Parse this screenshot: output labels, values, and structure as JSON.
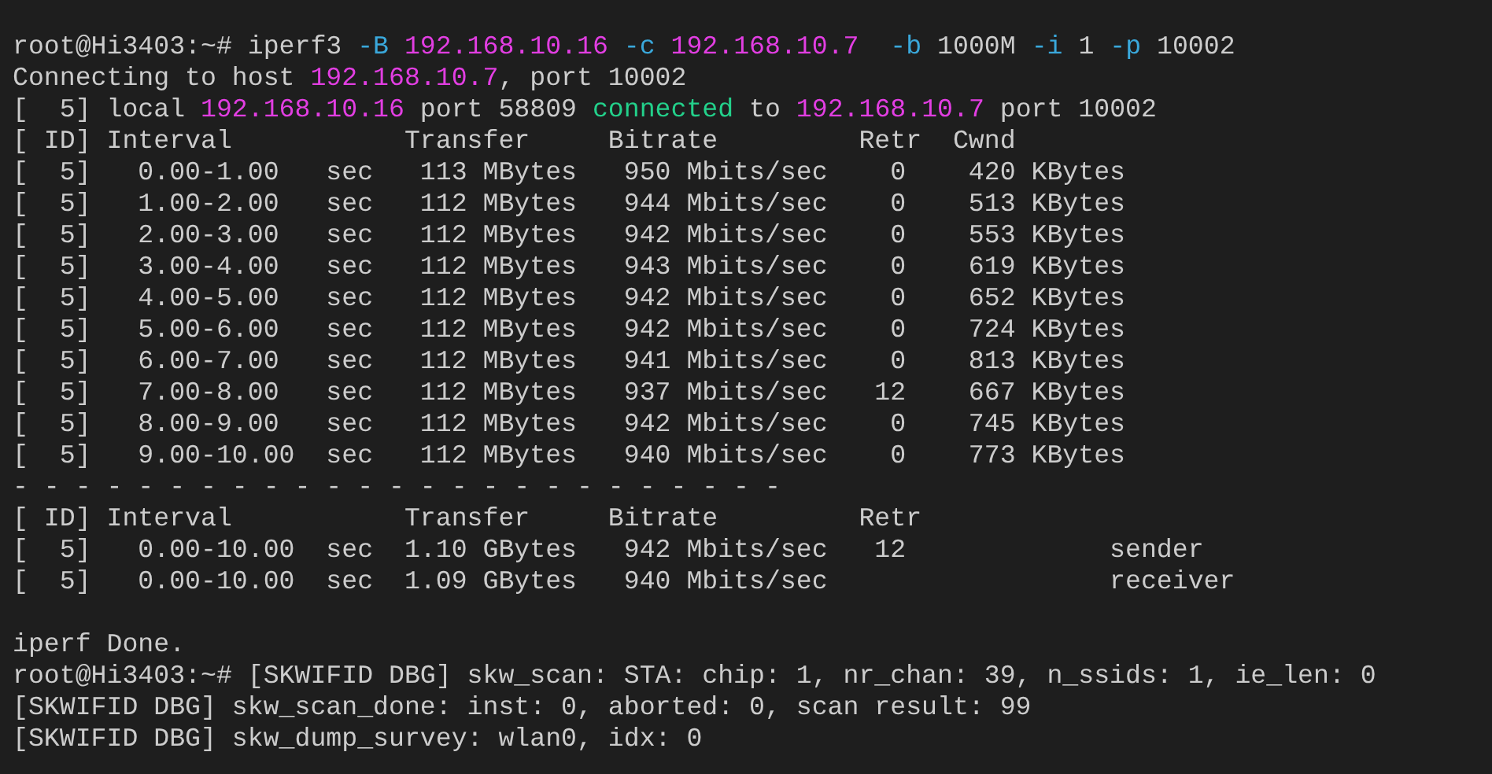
{
  "terminal": {
    "lines": [
      {
        "segments": [
          {
            "text": "root@Hi3403:~# iperf3 ",
            "kind": "plain"
          },
          {
            "text": "-B ",
            "kind": "option"
          },
          {
            "text": "192.168.10.16 ",
            "kind": "address"
          },
          {
            "text": "-c ",
            "kind": "option"
          },
          {
            "text": "192.168.10.7  ",
            "kind": "address"
          },
          {
            "text": "-b",
            "kind": "option"
          },
          {
            "text": " 1000M ",
            "kind": "plain"
          },
          {
            "text": "-i",
            "kind": "option"
          },
          {
            "text": " 1 ",
            "kind": "plain"
          },
          {
            "text": "-p",
            "kind": "option"
          },
          {
            "text": " 10002",
            "kind": "plain"
          }
        ]
      },
      {
        "segments": [
          {
            "text": "Connecting to host ",
            "kind": "plain"
          },
          {
            "text": "192.168.10.7",
            "kind": "address"
          },
          {
            "text": ", port 10002",
            "kind": "plain"
          }
        ]
      },
      {
        "segments": [
          {
            "text": "[  5] local ",
            "kind": "plain"
          },
          {
            "text": "192.168.10.16",
            "kind": "address"
          },
          {
            "text": " port 58809 ",
            "kind": "plain"
          },
          {
            "text": "connected",
            "kind": "status"
          },
          {
            "text": " to ",
            "kind": "plain"
          },
          {
            "text": "192.168.10.7",
            "kind": "address"
          },
          {
            "text": " port 10002",
            "kind": "plain"
          }
        ]
      },
      {
        "segments": [
          {
            "text": "[ ID] Interval           Transfer     Bitrate         Retr  Cwnd",
            "kind": "plain"
          }
        ]
      },
      {
        "segments": [
          {
            "text": "[  5]   0.00-1.00   sec   113 MBytes   950 Mbits/sec    0    420 KBytes",
            "kind": "plain"
          }
        ]
      },
      {
        "segments": [
          {
            "text": "[  5]   1.00-2.00   sec   112 MBytes   944 Mbits/sec    0    513 KBytes",
            "kind": "plain"
          }
        ]
      },
      {
        "segments": [
          {
            "text": "[  5]   2.00-3.00   sec   112 MBytes   942 Mbits/sec    0    553 KBytes",
            "kind": "plain"
          }
        ]
      },
      {
        "segments": [
          {
            "text": "[  5]   3.00-4.00   sec   112 MBytes   943 Mbits/sec    0    619 KBytes",
            "kind": "plain"
          }
        ]
      },
      {
        "segments": [
          {
            "text": "[  5]   4.00-5.00   sec   112 MBytes   942 Mbits/sec    0    652 KBytes",
            "kind": "plain"
          }
        ]
      },
      {
        "segments": [
          {
            "text": "[  5]   5.00-6.00   sec   112 MBytes   942 Mbits/sec    0    724 KBytes",
            "kind": "plain"
          }
        ]
      },
      {
        "segments": [
          {
            "text": "[  5]   6.00-7.00   sec   112 MBytes   941 Mbits/sec    0    813 KBytes",
            "kind": "plain"
          }
        ]
      },
      {
        "segments": [
          {
            "text": "[  5]   7.00-8.00   sec   112 MBytes   937 Mbits/sec   12    667 KBytes",
            "kind": "plain"
          }
        ]
      },
      {
        "segments": [
          {
            "text": "[  5]   8.00-9.00   sec   112 MBytes   942 Mbits/sec    0    745 KBytes",
            "kind": "plain"
          }
        ]
      },
      {
        "segments": [
          {
            "text": "[  5]   9.00-10.00  sec   112 MBytes   940 Mbits/sec    0    773 KBytes",
            "kind": "plain"
          }
        ]
      },
      {
        "segments": [
          {
            "text": "- - - - - - - - - - - - - - - - - - - - - - - - -",
            "kind": "plain"
          }
        ]
      },
      {
        "segments": [
          {
            "text": "[ ID] Interval           Transfer     Bitrate         Retr",
            "kind": "plain"
          }
        ]
      },
      {
        "segments": [
          {
            "text": "[  5]   0.00-10.00  sec  1.10 GBytes   942 Mbits/sec   12             sender",
            "kind": "plain"
          }
        ]
      },
      {
        "segments": [
          {
            "text": "[  5]   0.00-10.00  sec  1.09 GBytes   940 Mbits/sec                  receiver",
            "kind": "plain"
          }
        ]
      },
      {
        "gap_before": true,
        "segments": [
          {
            "text": "iperf Done.",
            "kind": "plain"
          }
        ]
      },
      {
        "segments": [
          {
            "text": "root@Hi3403:~# [SKWIFID DBG] skw_scan: STA: chip: 1, nr_chan: 39, n_ssids: 1, ie_len: 0",
            "kind": "plain"
          }
        ]
      },
      {
        "segments": [
          {
            "text": "[SKWIFID DBG] skw_scan_done: inst: 0, aborted: 0, scan result: 99",
            "kind": "plain"
          }
        ]
      },
      {
        "segments": [
          {
            "text": "[SKWIFID DBG] skw_dump_survey: wlan0, idx: 0",
            "kind": "plain"
          }
        ]
      }
    ]
  }
}
